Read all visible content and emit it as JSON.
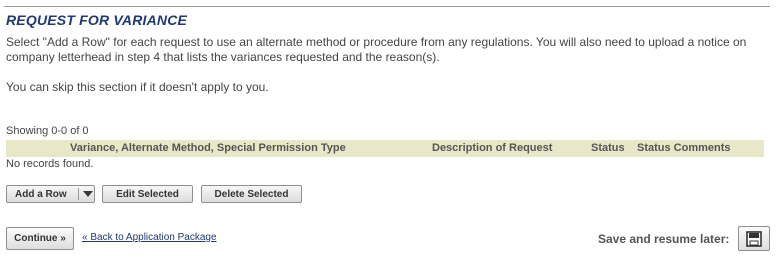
{
  "section": {
    "title": "REQUEST FOR VARIANCE",
    "description": "Select \"Add a Row\" for each request to use an alternate method or procedure from any regulations. You will also need to upload a notice on company letterhead in step 4 that lists the variances requested and the reason(s).",
    "skip_note": "You can skip this section if it doesn't apply to you."
  },
  "grid": {
    "showing_text": "Showing 0-0 of 0",
    "columns": [
      "Variance, Alternate Method, Special Permission Type",
      "Description of Request",
      "Status",
      "Status Comments"
    ],
    "empty_text": "No records found."
  },
  "actions": {
    "add_row_label": "Add a Row",
    "edit_selected_label": "Edit Selected",
    "delete_selected_label": "Delete Selected"
  },
  "footer": {
    "continue_label": "Continue »",
    "back_link_label": "« Back to Application Package",
    "save_resume_label": "Save and resume later:"
  },
  "icons": {
    "add_row_dropdown": "chevron-down-icon",
    "save": "save-icon"
  },
  "colors": {
    "title": "#1f3a6e",
    "grid_header_bg": "#e8e8c8",
    "link": "#1f3a6e"
  }
}
